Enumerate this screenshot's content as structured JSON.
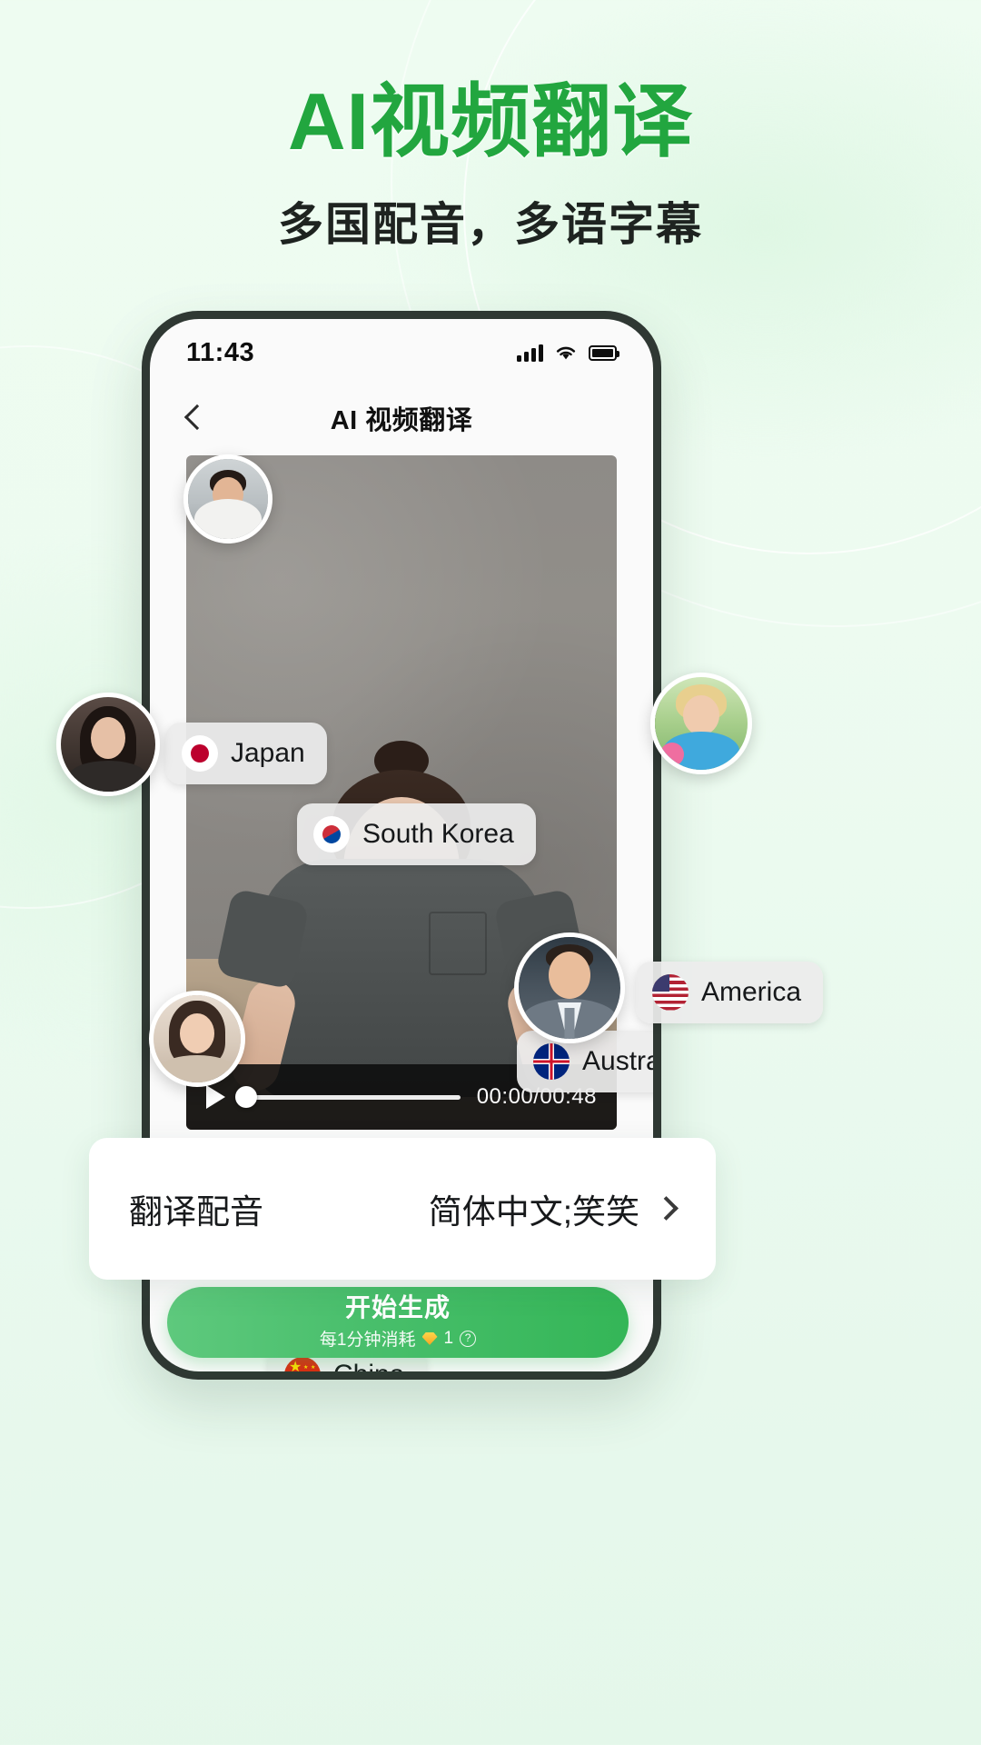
{
  "hero": {
    "title": "AI视频翻译",
    "subtitle": "多国配音，多语字幕",
    "accent_color": "#22a63f"
  },
  "phone": {
    "status_bar": {
      "time": "11:43",
      "signal_icon": "signal-bars-icon",
      "wifi_icon": "wifi-icon",
      "battery_icon": "battery-icon"
    },
    "nav_bar": {
      "back_icon": "back-chevron-icon",
      "title": "AI 视频翻译"
    },
    "video": {
      "play_icon": "play-icon",
      "current_time": "00:00",
      "total_time": "00:48",
      "time_display": "00:00/00:48",
      "progress_percent": 2
    },
    "country_pills": [
      {
        "label": "South Korea",
        "flag": "flag-south-korea-icon"
      },
      {
        "label": "Japan",
        "flag": "flag-japan-icon"
      },
      {
        "label": "Australia",
        "flag": "flag-australia-icon"
      },
      {
        "label": "America",
        "flag": "flag-america-icon"
      },
      {
        "label": "China",
        "flag": "flag-china-icon"
      }
    ],
    "avatars": [
      {
        "name": "avatar-korean-man"
      },
      {
        "name": "avatar-japanese-woman"
      },
      {
        "name": "avatar-australian-child"
      },
      {
        "name": "avatar-american-man"
      },
      {
        "name": "avatar-chinese-woman"
      }
    ],
    "option_row": {
      "label": "翻译配音",
      "value": "简体中文;笑笑",
      "chevron_icon": "chevron-right-icon"
    },
    "cta": {
      "main_label": "开始生成",
      "sub_prefix": "每1分钟消耗",
      "gem_icon": "gem-icon",
      "cost": "1",
      "help_icon": "question-mark-icon",
      "gradient_start": "#5ec97d",
      "gradient_end": "#34b657"
    }
  }
}
